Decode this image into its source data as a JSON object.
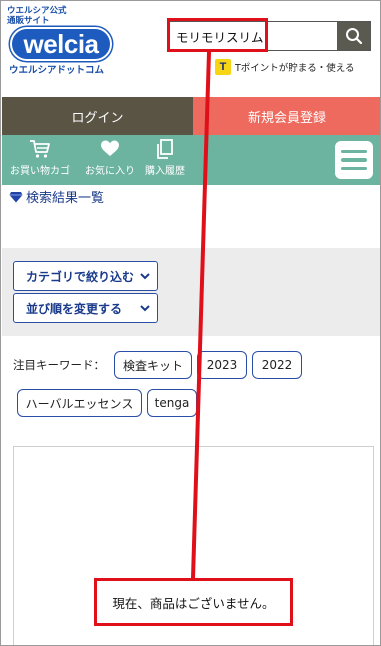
{
  "header": {
    "logo_tagline_1": "ウエルシア公式",
    "logo_tagline_2": "通販サイト",
    "logo_wordmark": "welcia",
    "logo_subtitle": "ウエルシアドットコム",
    "tpoint_logo": "T",
    "tpoint_text": "Tポイントが貯まる・使える"
  },
  "search": {
    "value": "モリモリスリム",
    "button_icon": "search-icon"
  },
  "auth": {
    "login_label": "ログイン",
    "register_label": "新規会員登録"
  },
  "nav": {
    "items": [
      {
        "label": "お買い物カゴ",
        "icon": "cart-icon"
      },
      {
        "label": "お気に入り",
        "icon": "heart-icon"
      },
      {
        "label": "購入履歴",
        "icon": "copy-icon"
      }
    ],
    "menu_icon": "hamburger-icon"
  },
  "breadcrumb": {
    "label": "検索結果一覧",
    "icon": "diamond-icon"
  },
  "filters": {
    "category_label": "カテゴリで絞り込む",
    "sort_label": "並び順を変更する"
  },
  "keywords": {
    "label": "注目キーワード：",
    "items": [
      "検査キット",
      "2023",
      "2022",
      "ハーバルエッセンス",
      "tenga"
    ]
  },
  "results": {
    "empty_message": "現在、商品はございません。"
  },
  "colors": {
    "brand_blue": "#1d5bbf",
    "login_bg": "#5a5445",
    "register_bg": "#ee6a5e",
    "nav_green": "#6cb3a0",
    "annotation_red": "#e0101a"
  }
}
